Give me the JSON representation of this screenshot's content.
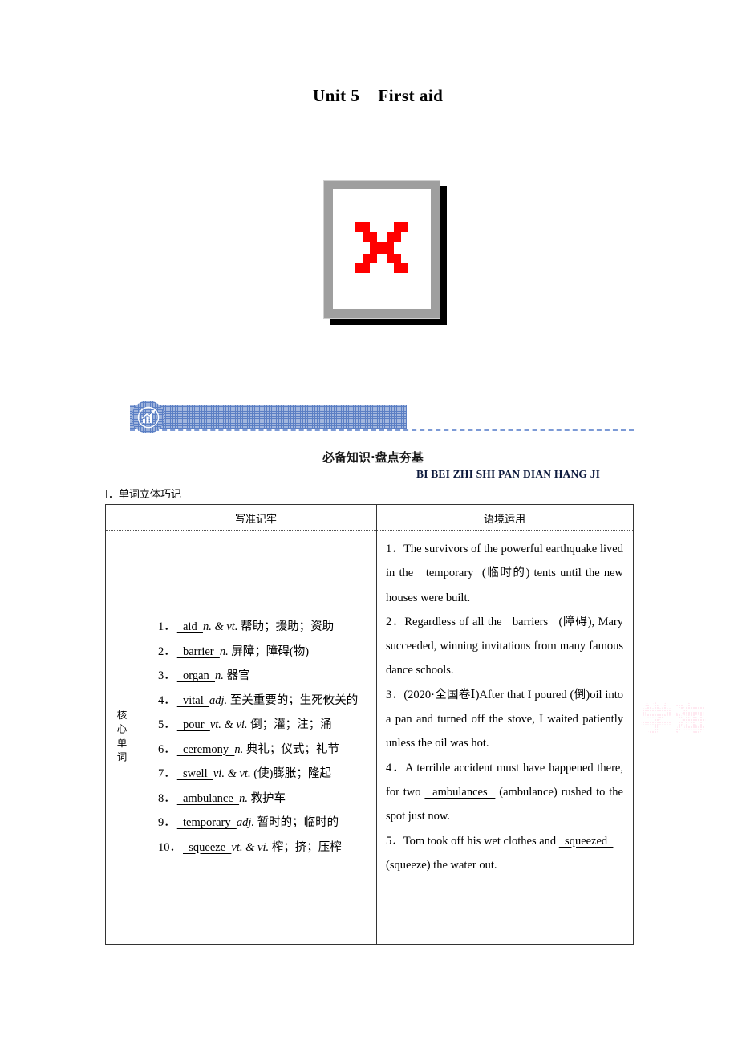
{
  "page": {
    "title": "Unit 5    First aid",
    "watermark_text": "学海"
  },
  "broken_image": {
    "name": "broken-image-placeholder",
    "icon": "red-x-icon"
  },
  "banner": {
    "icon": "bar-chart-growth-icon",
    "accent_color": "#5b7fc4",
    "section_title_cn": "必备知识·盘点夯基",
    "section_title_pinyin": "BI BEI ZHI SHI PAN DIAN HANG JI",
    "subsection_title": "Ⅰ．单词立体巧记"
  },
  "table": {
    "headers": {
      "corner": "",
      "col_write": "写准记牢",
      "col_context": "语境运用"
    },
    "row_label": "核心单词",
    "words": [
      {
        "num": "1．",
        "blank": "  aid  ",
        "pos": "n. & vt.",
        "meaning": "帮助；援助；资助"
      },
      {
        "num": "2．",
        "blank": "  barrier  ",
        "pos": "n.",
        "meaning": "屏障；障碍(物)"
      },
      {
        "num": "3．",
        "blank": "  organ  ",
        "pos": "n.",
        "meaning": "器官"
      },
      {
        "num": "4．",
        "blank": "  vital  ",
        "pos": "adj.",
        "meaning": "至关重要的；生死攸关的"
      },
      {
        "num": "5．",
        "blank": "  pour  ",
        "pos": "vt. & vi.",
        "meaning": "倒；灌；注；涌"
      },
      {
        "num": "6．",
        "blank": "  ceremony  ",
        "pos": "n.",
        "meaning": "典礼；仪式；礼节"
      },
      {
        "num": "7．",
        "blank": "  swell  ",
        "pos": "vi. & vt.",
        "meaning": "(使)膨胀；隆起"
      },
      {
        "num": "8．",
        "blank": "  ambulance  ",
        "pos": "n.",
        "meaning": "救护车"
      },
      {
        "num": "9．",
        "blank": "  temporary  ",
        "pos": "adj.",
        "meaning": "暂时的；临时的"
      },
      {
        "num": "10．",
        "blank": "  squeeze  ",
        "pos": "vt. & vi.",
        "meaning": "榨；挤；压榨"
      }
    ],
    "context": [
      {
        "num": "1．",
        "pre": "The survivors of the powerful earthquake lived in the ",
        "blank": "  temporary  ",
        "post": "(临时的) tents until the new houses were built."
      },
      {
        "num": "2．",
        "pre": "Regardless of all the ",
        "blank": "  barriers  ",
        "post": " (障碍), Mary succeeded, winning invitations from many famous dance schools."
      },
      {
        "num": "3．",
        "pre": "(2020·全国卷Ⅰ)After that I ",
        "blank": "poured",
        "post": " (倒)oil into a pan and turned off the stove, I waited patiently unless the oil was hot."
      },
      {
        "num": "4．",
        "pre": "A terrible accident must have happened there, for two ",
        "blank": "  ambulances  ",
        "post": " (ambulance) rushed to the spot just now."
      },
      {
        "num": "5．",
        "pre": "Tom took off his wet clothes and ",
        "blank": "  squeezed  ",
        "post": " (squeeze) the water out."
      }
    ]
  }
}
